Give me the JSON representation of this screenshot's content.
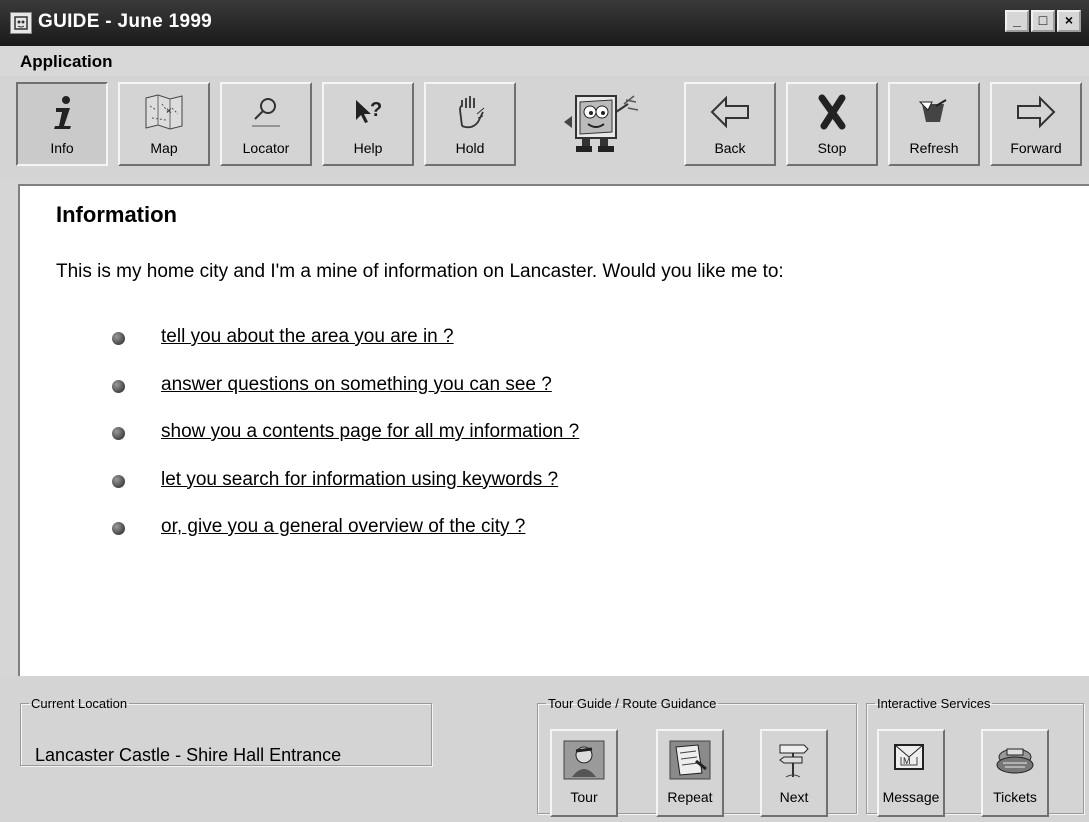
{
  "window": {
    "title": "GUIDE - June 1999",
    "controls": {
      "minimize": "_",
      "maximize": "□",
      "close": "×"
    }
  },
  "menu": {
    "items": [
      "Application"
    ]
  },
  "toolbar": {
    "buttons": [
      {
        "label": "Info",
        "icon": "info-icon",
        "pressed": true
      },
      {
        "label": "Map",
        "icon": "map-icon"
      },
      {
        "label": "Locator",
        "icon": "magnifier-icon"
      },
      {
        "label": "Help",
        "icon": "help-pointer-icon"
      },
      {
        "label": "Hold",
        "icon": "hand-icon"
      },
      {
        "label": "Back",
        "icon": "arrow-left-icon"
      },
      {
        "label": "Stop",
        "icon": "stop-x-icon"
      },
      {
        "label": "Refresh",
        "icon": "refresh-icon"
      },
      {
        "label": "Forward",
        "icon": "arrow-right-icon"
      }
    ],
    "mascot": "mascot-icon"
  },
  "content": {
    "heading": "Information",
    "intro": "This is my home city and I'm a mine of information on Lancaster. Would you like me to:",
    "links": [
      "tell you about the area you are in ?",
      "answer questions on something you can see ?",
      "show you a contents page for all my information ?",
      "let you search for information using keywords ?",
      "or, give you a general overview of the city ?"
    ]
  },
  "location": {
    "legend": "Current Location",
    "value": "Lancaster Castle - Shire Hall Entrance"
  },
  "tour": {
    "legend": "Tour Guide / Route Guidance",
    "buttons": [
      {
        "label": "Tour",
        "icon": "tour-guide-icon"
      },
      {
        "label": "Repeat",
        "icon": "repeat-notes-icon"
      },
      {
        "label": "Next",
        "icon": "signpost-icon"
      }
    ]
  },
  "services": {
    "legend": "Interactive Services",
    "buttons": [
      {
        "label": "Message",
        "icon": "message-icon"
      },
      {
        "label": "Tickets",
        "icon": "tickets-icon"
      }
    ]
  }
}
